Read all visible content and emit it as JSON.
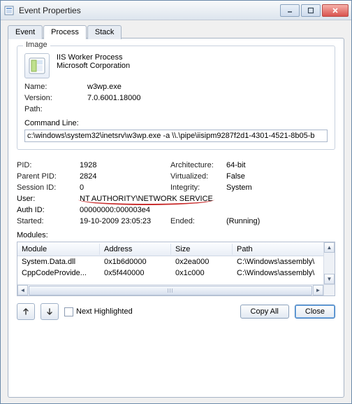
{
  "window": {
    "title": "Event Properties"
  },
  "tabs": {
    "event": "Event",
    "process": "Process",
    "stack": "Stack",
    "active": "process"
  },
  "image_group": {
    "legend": "Image",
    "product_name": "IIS Worker Process",
    "company": "Microsoft Corporation",
    "name_label": "Name:",
    "name_value": "w3wp.exe",
    "version_label": "Version:",
    "version_value": "7.0.6001.18000",
    "path_label": "Path:",
    "path_value": "",
    "cmdline_label": "Command Line:",
    "cmdline_value": "c:\\windows\\system32\\inetsrv\\w3wp.exe -a \\\\.\\pipe\\iisipm9287f2d1-4301-4521-8b05-b"
  },
  "process": {
    "pid_label": "PID:",
    "pid_value": "1928",
    "arch_label": "Architecture:",
    "arch_value": "64-bit",
    "ppid_label": "Parent PID:",
    "ppid_value": "2824",
    "virt_label": "Virtualized:",
    "virt_value": "False",
    "sid_label": "Session ID:",
    "sid_value": "0",
    "integ_label": "Integrity:",
    "integ_value": "System",
    "user_label": "User:",
    "user_value": "NT AUTHORITY\\NETWORK SERVICE",
    "authid_label": "Auth ID:",
    "authid_value": "00000000:000003e4",
    "started_label": "Started:",
    "started_value": "19-10-2009 23:05:23",
    "ended_label": "Ended:",
    "ended_value": "(Running)",
    "modules_label": "Modules:"
  },
  "modules": {
    "headers": [
      "Module",
      "Address",
      "Size",
      "Path"
    ],
    "rows": [
      {
        "module": "System.Data.dll",
        "address": "0x1b6d0000",
        "size": "0x2ea000",
        "path": "C:\\Windows\\assembly\\"
      },
      {
        "module": "CppCodeProvide...",
        "address": "0x5f440000",
        "size": "0x1c000",
        "path": "C:\\Windows\\assembly\\"
      }
    ]
  },
  "bottom": {
    "next_highlighted": "Next Highlighted",
    "copy_all": "Copy All",
    "close": "Close"
  }
}
